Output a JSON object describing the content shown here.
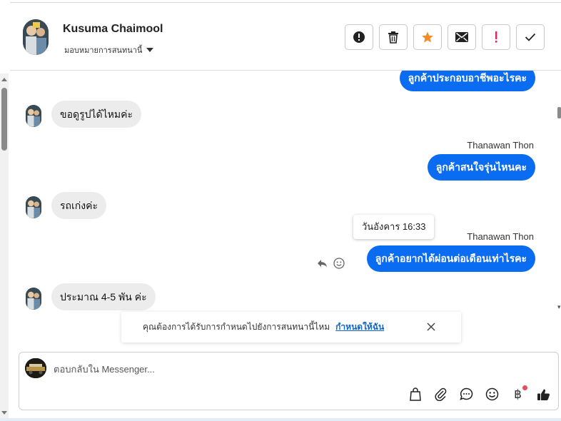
{
  "header": {
    "contact_name": "Kusuma Chaimool",
    "assign_label": "มอบหมายการสนทนานี้",
    "actions": [
      {
        "name": "mark-spam-button",
        "icon": "alert-circle-icon"
      },
      {
        "name": "delete-button",
        "icon": "trash-icon"
      },
      {
        "name": "star-button",
        "icon": "star-icon"
      },
      {
        "name": "mark-unread-button",
        "icon": "envelope-icon"
      },
      {
        "name": "follow-up-button",
        "icon": "exclamation-icon"
      },
      {
        "name": "mark-done-button",
        "icon": "check-icon"
      }
    ],
    "accent_star": "#f28c28",
    "accent_alert": "#e0245e"
  },
  "messages": [
    {
      "direction": "out",
      "text": "ลูกค้าประกอบอาชีพอะไรคะ"
    },
    {
      "direction": "in",
      "text": "ขอดูรูปได้ไหมค่ะ"
    },
    {
      "direction": "out",
      "sender": "Thanawan Thon",
      "text": "ลูกค้าสนใจรุ่นไหนคะ"
    },
    {
      "direction": "in",
      "text": "รถเก่งค่ะ"
    },
    {
      "direction": "out",
      "sender": "Thanawan Thon",
      "text": "ลูกค้าอยากได้ผ่อนต่อเดือนเท่าไรคะ",
      "timestamp_tooltip": "วันอังคาร 16:33"
    },
    {
      "direction": "in",
      "text": "ประมาณ 4-5 พัน ค่ะ"
    }
  ],
  "hover_icons": [
    "reply-icon",
    "emoji-react-icon"
  ],
  "notice": {
    "text": "คุณต้องการได้รับการกำหนดไปยังการสนทนานี้ไหม",
    "link": "กำหนดให้ฉัน"
  },
  "composer": {
    "placeholder": "ตอบกลับใน Messenger...",
    "tools": [
      "shopping-bag-icon",
      "paperclip-icon",
      "saved-reply-icon",
      "emoji-icon",
      "baht-payment-icon",
      "thumbs-up-icon"
    ],
    "payment_symbol": "฿",
    "brand_blue": "#0a6cf1"
  }
}
